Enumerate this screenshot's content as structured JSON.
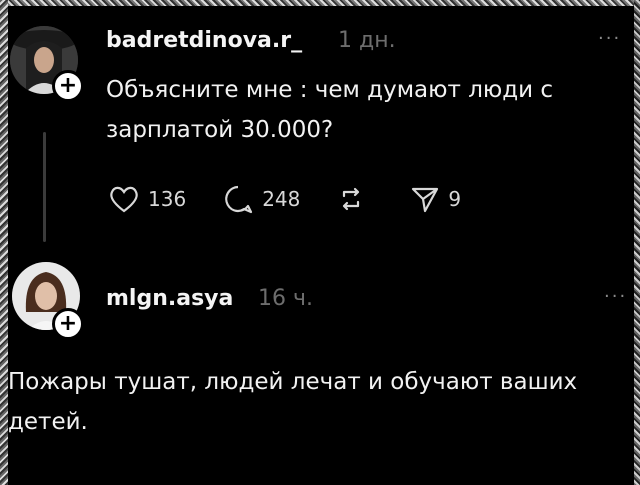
{
  "posts": [
    {
      "username": "badretdinova.r_",
      "time": "1 дн.",
      "more": "···",
      "text": "Объясните мне : чем думают люди с зарплатой 30.000?",
      "actions": {
        "likes": "136",
        "comments": "248",
        "shares": "9"
      }
    },
    {
      "username": "mlgn.asya",
      "time": "16 ч.",
      "more": "···",
      "text": "Пожары тушат, людей лечат и обучают ваших детей."
    }
  ],
  "icons": [
    "heart-icon",
    "comment-icon",
    "repost-icon",
    "share-icon",
    "follow-plus-icon",
    "more-icon"
  ],
  "colors": {
    "background": "#000000",
    "text": "#f2f2f2",
    "muted": "#6d6d6d"
  }
}
